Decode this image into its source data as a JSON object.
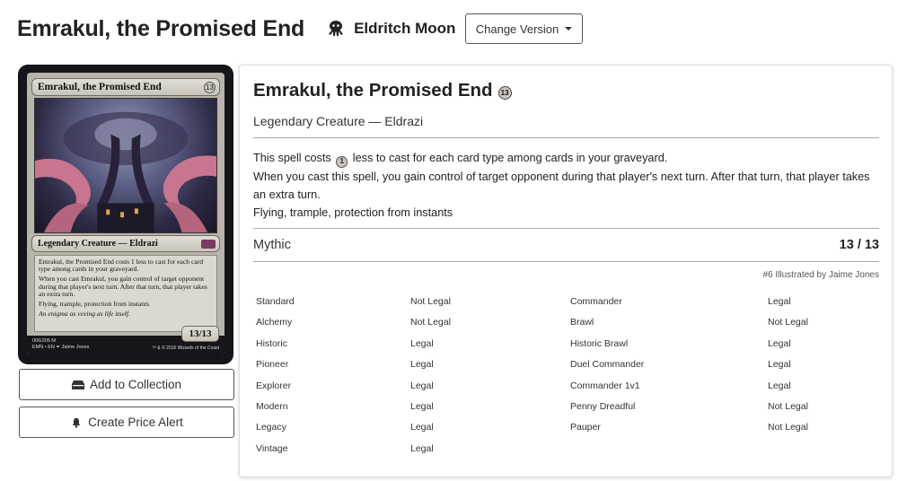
{
  "header": {
    "title": "Emrakul, the Promised End",
    "set_name": "Eldritch Moon",
    "change_version_label": "Change Version"
  },
  "card_image": {
    "name": "Emrakul, the Promised End",
    "cost": "13",
    "type": "Legendary Creature — Eldrazi",
    "rules": [
      "Emrakul, the Promised End costs 1 less to cast for each card type among cards in your graveyard.",
      "When you cast Emrakul, you gain control of target opponent during that player's next turn. After that turn, that player takes an extra turn.",
      "Flying, trample, protection from instants"
    ],
    "flavor": "An enigma as vexing as life itself.",
    "pt": "13/13",
    "footer_line1": "006/205 M",
    "footer_line2": "EMN • EN ✒ Jaime Jones",
    "copyright": "™ & © 2016 Wizards of the Coast"
  },
  "actions": {
    "add_collection": "Add to Collection",
    "price_alert": "Create Price Alert"
  },
  "details": {
    "name": "Emrakul, the Promised End",
    "mana_cost": "13",
    "type_line": "Legendary Creature — Eldrazi",
    "oracle": {
      "line1_pre": "This spell costs",
      "line1_mana": "1",
      "line1_post": "less to cast for each card type among cards in your graveyard.",
      "line2": "When you cast this spell, you gain control of target opponent during that player's next turn. After that turn, that player takes an extra turn.",
      "line3": "Flying, trample, protection from instants"
    },
    "rarity": "Mythic",
    "power_toughness": "13 / 13",
    "illustrated": "#6 Illustrated by Jaime Jones"
  },
  "legality": {
    "left": [
      {
        "format": "Standard",
        "status": "Not Legal"
      },
      {
        "format": "Alchemy",
        "status": "Not Legal"
      },
      {
        "format": "Historic",
        "status": "Legal"
      },
      {
        "format": "Pioneer",
        "status": "Legal"
      },
      {
        "format": "Explorer",
        "status": "Legal"
      },
      {
        "format": "Modern",
        "status": "Legal"
      },
      {
        "format": "Legacy",
        "status": "Legal"
      },
      {
        "format": "Vintage",
        "status": "Legal"
      }
    ],
    "right": [
      {
        "format": "Commander",
        "status": "Legal"
      },
      {
        "format": "Brawl",
        "status": "Not Legal"
      },
      {
        "format": "Historic Brawl",
        "status": "Legal"
      },
      {
        "format": "Duel Commander",
        "status": "Legal"
      },
      {
        "format": "Commander 1v1",
        "status": "Legal"
      },
      {
        "format": "Penny Dreadful",
        "status": "Not Legal"
      },
      {
        "format": "Pauper",
        "status": "Not Legal"
      }
    ]
  }
}
